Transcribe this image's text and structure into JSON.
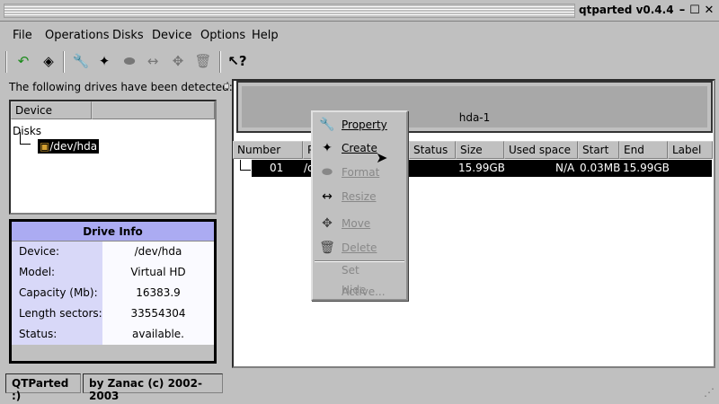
{
  "window": {
    "title": "qtparted v0.4.4"
  },
  "menu": {
    "items": [
      "File",
      "Operations",
      "Disks",
      "Device",
      "Options",
      "Help"
    ]
  },
  "toolbar": {
    "icons": [
      "undo-icon",
      "commit-icon",
      "property-icon",
      "create-icon",
      "format-icon",
      "resize-icon",
      "move-icon",
      "delete-icon",
      "whats-this-icon"
    ]
  },
  "left": {
    "detected_text": "The following drives have been detected:",
    "tree_header": "Device",
    "tree_root": "Disks",
    "tree_item": "/dev/hda"
  },
  "drive_info": {
    "title": "Drive Info",
    "rows": [
      {
        "label": "Device:",
        "value": "/dev/hda"
      },
      {
        "label": "Model:",
        "value": "Virtual HD"
      },
      {
        "label": "Capacity (Mb):",
        "value": "16383.9"
      },
      {
        "label": "Length sectors:",
        "value": "33554304"
      },
      {
        "label": "Status:",
        "value": "available."
      }
    ]
  },
  "disk_map": {
    "partition_label": "hda-1"
  },
  "table": {
    "headers": [
      "Number",
      "P",
      "Status",
      "Size",
      "Used space",
      "Start",
      "End",
      "Label"
    ],
    "row": {
      "number": "01",
      "partition": "/d",
      "size": "15.99GB",
      "used": "N/A",
      "start": "0.03MB",
      "end": "15.99GB"
    }
  },
  "context_menu": {
    "items": [
      {
        "label": "Property",
        "icon": "wrench-icon",
        "enabled": true
      },
      {
        "label": "Create",
        "icon": "create-icon",
        "enabled": true
      },
      {
        "label": "Format",
        "icon": "eraser-icon",
        "enabled": false
      },
      {
        "label": "Resize",
        "icon": "resize-icon",
        "enabled": false
      },
      {
        "label": "Move",
        "icon": "move-icon",
        "enabled": false
      },
      {
        "label": "Delete",
        "icon": "trash-icon",
        "enabled": false
      },
      {
        "label": "Set Active...",
        "enabled": false
      },
      {
        "label": "Hide",
        "enabled": false
      }
    ]
  },
  "status": {
    "left": "QTParted :)",
    "right": "by Zanac (c) 2002-2003"
  }
}
